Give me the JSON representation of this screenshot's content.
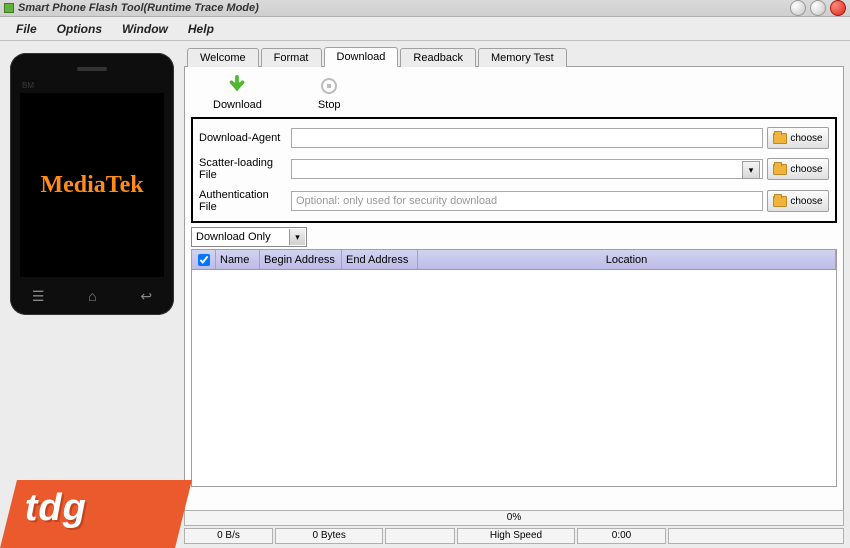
{
  "titlebar": {
    "title": "Smart Phone Flash Tool(Runtime Trace Mode)"
  },
  "menu": {
    "file": "File",
    "options": "Options",
    "window": "Window",
    "help": "Help"
  },
  "tabs": {
    "welcome": "Welcome",
    "format": "Format",
    "download": "Download",
    "readback": "Readback",
    "memtest": "Memory Test"
  },
  "actions": {
    "download": "Download",
    "stop": "Stop"
  },
  "filebox": {
    "da_label": "Download-Agent",
    "da_value": "",
    "scatter_label": "Scatter-loading File",
    "scatter_value": "",
    "auth_label": "Authentication File",
    "auth_value": "",
    "auth_placeholder": "Optional: only used for security download",
    "choose": "choose"
  },
  "mode": {
    "value": "Download Only"
  },
  "grid": {
    "col_name": "Name",
    "col_begin": "Begin Address",
    "col_end": "End Address",
    "col_location": "Location"
  },
  "status": {
    "progress": "0%",
    "speed": "0 B/s",
    "bytes": "0 Bytes",
    "blank1": "",
    "mode": "High Speed",
    "time": "0:00",
    "blank2": ""
  },
  "phone": {
    "brand": "MediaTek",
    "bm": "BM"
  },
  "watermark": {
    "text": "tdg"
  }
}
